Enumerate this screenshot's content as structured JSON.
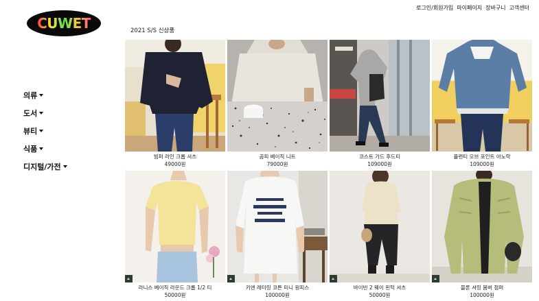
{
  "brand": {
    "logo_text": "CUWET"
  },
  "top_nav": [
    "로그인/회원가입",
    "마이페이지",
    "장바구니",
    "고객센터"
  ],
  "section_title": "2021 S/S 신상품",
  "categories": [
    "의류",
    "도서",
    "뷰티",
    "식품",
    "디지털/가전"
  ],
  "products": [
    {
      "name": "빔퍼 라인 크롭 셔츠",
      "price": "49000원"
    },
    {
      "name": "곰피 베이직 니트",
      "price": "79000원"
    },
    {
      "name": "코스트 가드 후드티",
      "price": "109000원"
    },
    {
      "name": "플렌티 오브 포인트 아노락",
      "price": "109000원"
    },
    {
      "name": "라니스 베이직 라운드 크롭 1/2 티",
      "price": "50000원"
    },
    {
      "name": "키엔 레터링 코튼 미니 원피스",
      "price": "100000원"
    },
    {
      "name": "바이빈 2 웨이 핀턱 셔츠",
      "price": "50000원"
    },
    {
      "name": "블론 셔링 봄버 점퍼",
      "price": "100000원"
    }
  ],
  "colors": {
    "logo_bg": "#0a0a0a",
    "accent_green": "#2c3e30"
  }
}
